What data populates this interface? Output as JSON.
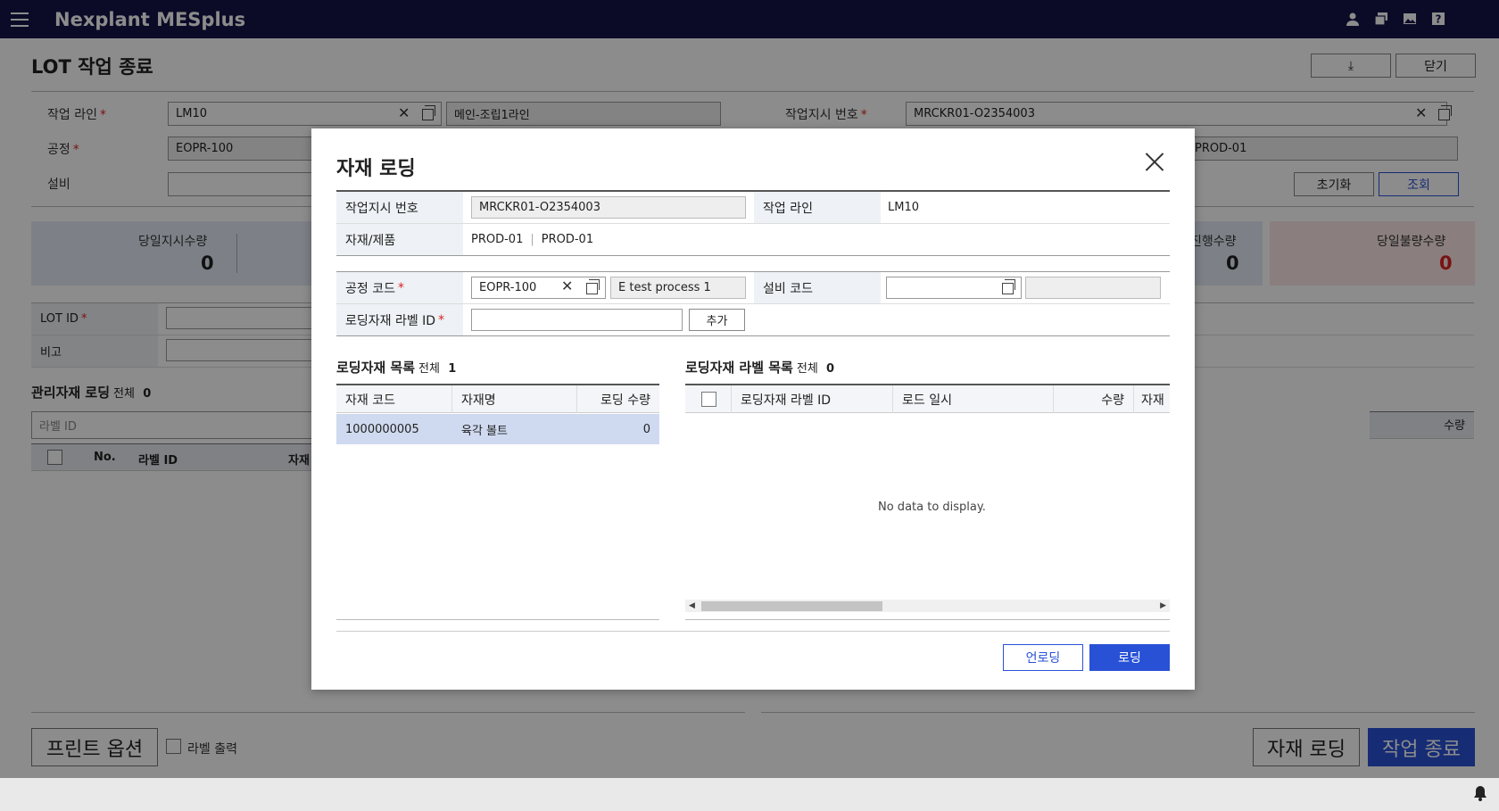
{
  "app": {
    "brand": "Nexplant MESplus"
  },
  "page": {
    "title": "LOT 작업 종료",
    "download_label": "⤓",
    "close_label": "닫기",
    "fields": {
      "line_label": "작업 라인",
      "line_value": "LM10",
      "line_name": "메인-조립1라인",
      "wo_label": "작업지시 번호",
      "wo_value": "MRCKR01-O2354003",
      "process_label": "공정",
      "process_value": "EOPR-100",
      "product_value": "PROD-01",
      "equip_label": "설비",
      "reset_label": "초기화",
      "search_label": "조회"
    },
    "kpis": [
      {
        "label": "당일지시수량",
        "value": "0"
      },
      {
        "label": "진행수량",
        "value": "0"
      },
      {
        "label": "당일불량수량",
        "value": "0"
      }
    ],
    "lot_id_label": "LOT ID",
    "remark_label": "비고",
    "managed_section": {
      "title": "관리자재 로딩",
      "count_label": "전체",
      "count": "0"
    },
    "label_id_placeholder": "라벨 ID",
    "qty_header": "수량",
    "grid_headers": [
      "No.",
      "라벨 ID",
      "자재"
    ],
    "print_option_label": "프린트 옵션",
    "label_print_label": "라벨 출력",
    "material_loading_label": "자재 로딩",
    "job_end_label": "작업 종료"
  },
  "modal": {
    "title": "자재 로딩",
    "wo_label": "작업지시 번호",
    "wo_value": "MRCKR01-O2354003",
    "line_label": "작업 라인",
    "line_value": "LM10",
    "material_label": "자재/제품",
    "material_value_1": "PROD-01",
    "material_value_2": "PROD-01",
    "process_code_label": "공정 코드",
    "process_code_value": "EOPR-100",
    "process_name_value": "E test process 1",
    "equip_code_label": "설비 코드",
    "equip_code_value": "",
    "equip_name_value": "",
    "label_id_label": "로딩자재 라벨 ID",
    "label_id_value": "",
    "add_label": "추가",
    "left_list": {
      "title": "로딩자재 목록",
      "count_label": "전체",
      "count": "1",
      "headers": [
        "자재 코드",
        "자재명",
        "로딩 수량"
      ],
      "rows": [
        {
          "code": "1000000005",
          "name": "육각 볼트",
          "qty": "0"
        }
      ]
    },
    "right_list": {
      "title": "로딩자재 라벨 목록",
      "count_label": "전체",
      "count": "0",
      "headers": [
        "로딩자재 라벨 ID",
        "로드 일시",
        "수량",
        "자재"
      ],
      "empty_text": "No data to display."
    },
    "unload_label": "언로딩",
    "load_label": "로딩"
  }
}
